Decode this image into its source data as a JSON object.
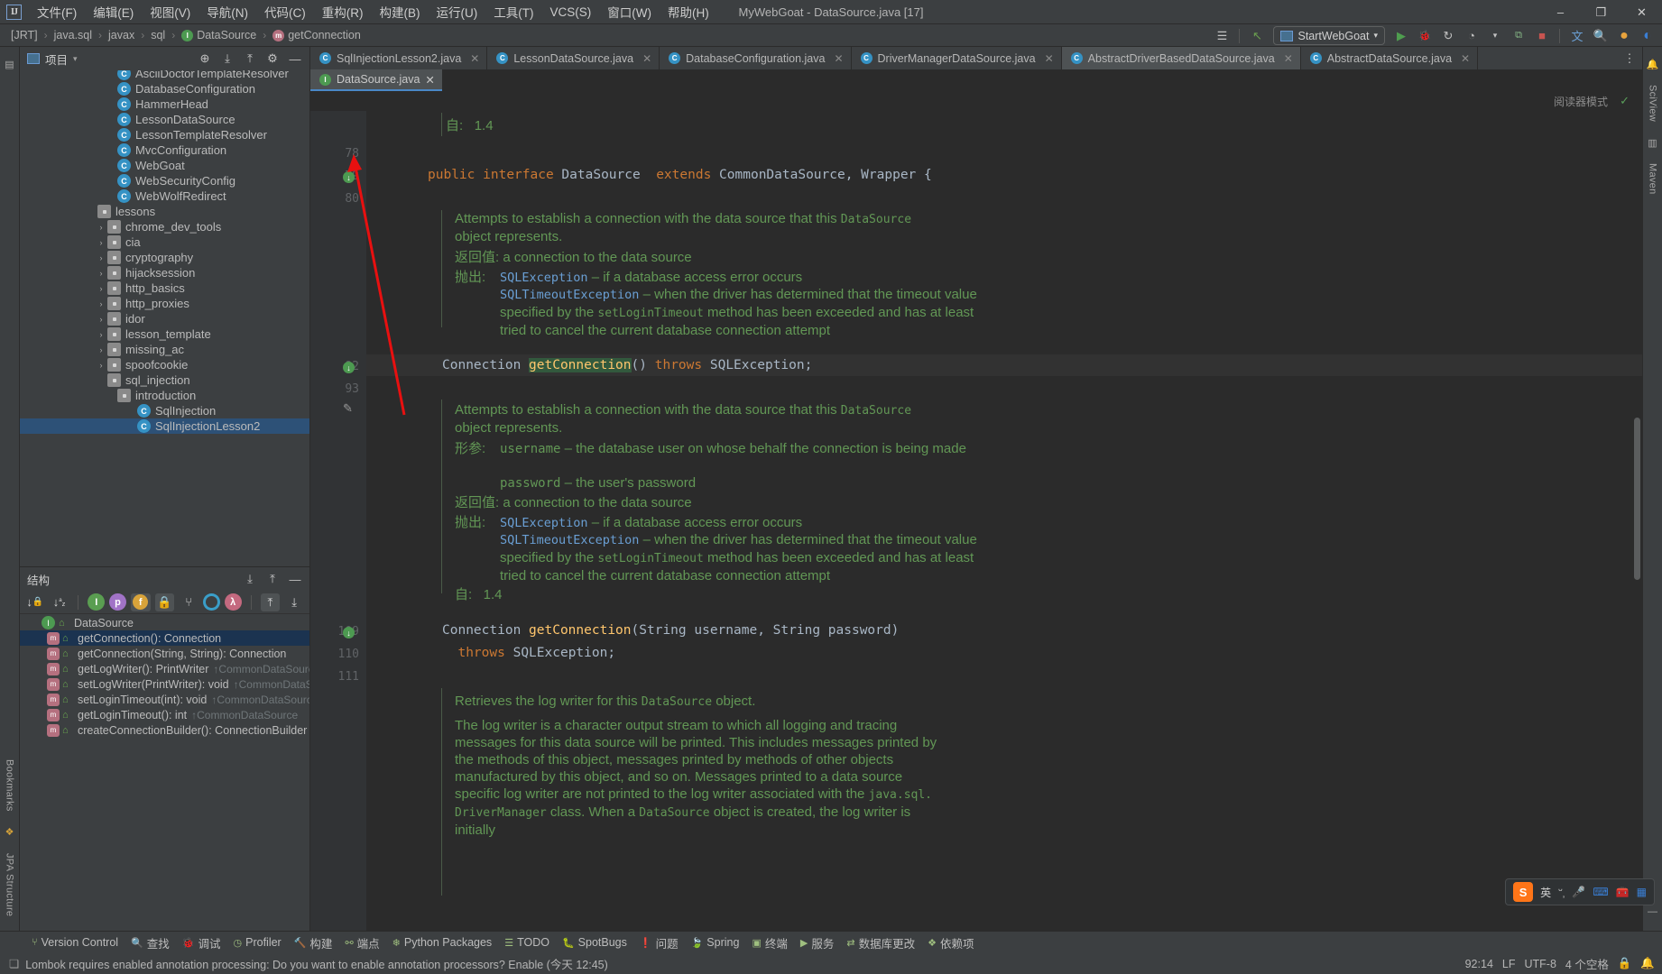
{
  "window": {
    "title": "MyWebGoat - DataSource.java [17]",
    "logo": "IJ",
    "minimize": "–",
    "maximize": "❐",
    "close": "✕"
  },
  "menu": {
    "items": [
      {
        "label": "文件(F)",
        "name": "menu-file"
      },
      {
        "label": "编辑(E)",
        "name": "menu-edit"
      },
      {
        "label": "视图(V)",
        "name": "menu-view"
      },
      {
        "label": "导航(N)",
        "name": "menu-navigate"
      },
      {
        "label": "代码(C)",
        "name": "menu-code"
      },
      {
        "label": "重构(R)",
        "name": "menu-refactor"
      },
      {
        "label": "构建(B)",
        "name": "menu-build"
      },
      {
        "label": "运行(U)",
        "name": "menu-run"
      },
      {
        "label": "工具(T)",
        "name": "menu-tools"
      },
      {
        "label": "VCS(S)",
        "name": "menu-vcs"
      },
      {
        "label": "窗口(W)",
        "name": "menu-window"
      },
      {
        "label": "帮助(H)",
        "name": "menu-help"
      }
    ]
  },
  "navbar": {
    "crumbs": [
      {
        "label": "[JRT]",
        "icon": ""
      },
      {
        "label": "java.sql",
        "icon": ""
      },
      {
        "label": "javax",
        "icon": ""
      },
      {
        "label": "sql",
        "icon": ""
      },
      {
        "label": "DataSource",
        "icon": "interface-icon"
      },
      {
        "label": "getConnection",
        "icon": "method-icon"
      }
    ],
    "separator": "›",
    "run_config": "StartWebGoat",
    "icons": {
      "profile": "☰",
      "back": "↖",
      "run": "▶",
      "debug": "🐞",
      "rerun": "↻",
      "coverage": "◔",
      "stop": "■",
      "translate": "文",
      "search": "🔍",
      "notify": "●",
      "updates": "◐"
    }
  },
  "project_panel": {
    "title": "项目",
    "dropdown": "▾",
    "actions": [
      "locate-icon",
      "expand-all-icon",
      "collapse-all-icon",
      "settings-icon",
      "hide-icon"
    ],
    "tree": [
      {
        "label": "AsciiDoctorTemplateResolver",
        "type": "class",
        "indent": 8,
        "arrow": "",
        "clipped": true
      },
      {
        "label": "DatabaseConfiguration",
        "type": "class",
        "indent": 8,
        "arrow": ""
      },
      {
        "label": "HammerHead",
        "type": "class",
        "indent": 8,
        "arrow": ""
      },
      {
        "label": "LessonDataSource",
        "type": "class",
        "indent": 8,
        "arrow": ""
      },
      {
        "label": "LessonTemplateResolver",
        "type": "class",
        "indent": 8,
        "arrow": ""
      },
      {
        "label": "MvcConfiguration",
        "type": "class",
        "indent": 8,
        "arrow": ""
      },
      {
        "label": "WebGoat",
        "type": "class-run",
        "indent": 8,
        "arrow": ""
      },
      {
        "label": "WebSecurityConfig",
        "type": "class",
        "indent": 8,
        "arrow": ""
      },
      {
        "label": "WebWolfRedirect",
        "type": "class",
        "indent": 8,
        "arrow": ""
      },
      {
        "label": "lessons",
        "type": "folder",
        "indent": 6,
        "arrow": "ⱟ"
      },
      {
        "label": "chrome_dev_tools",
        "type": "folder",
        "indent": 7,
        "arrow": "›"
      },
      {
        "label": "cia",
        "type": "folder",
        "indent": 7,
        "arrow": "›"
      },
      {
        "label": "cryptography",
        "type": "folder",
        "indent": 7,
        "arrow": "›"
      },
      {
        "label": "hijacksession",
        "type": "folder",
        "indent": 7,
        "arrow": "›"
      },
      {
        "label": "http_basics",
        "type": "folder",
        "indent": 7,
        "arrow": "›"
      },
      {
        "label": "http_proxies",
        "type": "folder",
        "indent": 7,
        "arrow": "›"
      },
      {
        "label": "idor",
        "type": "folder",
        "indent": 7,
        "arrow": "›"
      },
      {
        "label": "lesson_template",
        "type": "folder",
        "indent": 7,
        "arrow": "›"
      },
      {
        "label": "missing_ac",
        "type": "folder",
        "indent": 7,
        "arrow": "›"
      },
      {
        "label": "spoofcookie",
        "type": "folder",
        "indent": 7,
        "arrow": "›"
      },
      {
        "label": "sql_injection",
        "type": "folder",
        "indent": 7,
        "arrow": "ⱟ"
      },
      {
        "label": "introduction",
        "type": "folder",
        "indent": 8,
        "arrow": "ⱟ"
      },
      {
        "label": "SqlInjection",
        "type": "class",
        "indent": 10,
        "arrow": ""
      },
      {
        "label": "SqlInjectionLesson2",
        "type": "class",
        "indent": 10,
        "arrow": "",
        "selected": true
      }
    ]
  },
  "structure_panel": {
    "title": "结构",
    "toolbar_icons": [
      "sort-by-visibility-icon",
      "sort-alphabetically-icon",
      "show-inherited-icon",
      "show-properties-icon",
      "show-fields-icon",
      "show-non-public-icon",
      "group-icon",
      "show-anonymous-icon",
      "show-lambdas-icon",
      "expand-all-icon",
      "collapse-all-icon"
    ],
    "header_actions": [
      "expand-all-icon",
      "collapse-all-icon",
      "hide-icon"
    ],
    "items": [
      {
        "label": "DataSource",
        "type": "interface",
        "indent": 0,
        "arrow": "ⱟ",
        "lock": "⌂",
        "origin": ""
      },
      {
        "label": "getConnection(): Connection",
        "type": "method",
        "indent": 1,
        "arrow": "",
        "lock": "⌂",
        "origin": "",
        "selected": true
      },
      {
        "label": "getConnection(String, String): Connection",
        "type": "method",
        "indent": 1,
        "arrow": "",
        "lock": "⌂",
        "origin": ""
      },
      {
        "label": "getLogWriter(): PrintWriter",
        "type": "method",
        "indent": 1,
        "arrow": "",
        "lock": "⌂",
        "origin": "↑CommonDataSource"
      },
      {
        "label": "setLogWriter(PrintWriter): void",
        "type": "method",
        "indent": 1,
        "arrow": "",
        "lock": "⌂",
        "origin": "↑CommonDataSource"
      },
      {
        "label": "setLoginTimeout(int): void",
        "type": "method",
        "indent": 1,
        "arrow": "",
        "lock": "⌂",
        "origin": "↑CommonDataSource"
      },
      {
        "label": "getLoginTimeout(): int",
        "type": "method",
        "indent": 1,
        "arrow": "",
        "lock": "⌂",
        "origin": "↑CommonDataSource"
      },
      {
        "label": "createConnectionBuilder(): ConnectionBuilder",
        "type": "method",
        "indent": 1,
        "arrow": "",
        "lock": "⌂",
        "origin": ""
      }
    ]
  },
  "editor": {
    "tabs_row1": [
      {
        "label": "SqlInjectionLesson2.java",
        "icon": "class-icon",
        "active": false
      },
      {
        "label": "LessonDataSource.java",
        "icon": "class-icon",
        "active": false
      },
      {
        "label": "DatabaseConfiguration.java",
        "icon": "class-icon",
        "active": false
      },
      {
        "label": "DriverManagerDataSource.java",
        "icon": "class-icon",
        "active": false
      },
      {
        "label": "AbstractDriverBasedDataSource.java",
        "icon": "class-icon",
        "active": true
      },
      {
        "label": "AbstractDataSource.java",
        "icon": "class-icon",
        "active": false
      }
    ],
    "tabs_row2": [
      {
        "label": "DataSource.java",
        "icon": "interface-icon",
        "active": true
      }
    ],
    "tab_close": "✕",
    "reader_mode": "阅读器模式",
    "line_numbers": [
      "78",
      "79",
      "80",
      "92",
      "93",
      "109",
      "110",
      "111"
    ],
    "code_lines": [
      {
        "line": 79,
        "tokens": [
          {
            "t": "public",
            "c": "kw"
          },
          {
            "t": " ",
            "c": "plain"
          },
          {
            "t": "interface",
            "c": "kw"
          },
          {
            "t": " DataSource  ",
            "c": "cls"
          },
          {
            "t": "extends",
            "c": "kw"
          },
          {
            "t": " CommonDataSource, Wrapper {",
            "c": "cls"
          }
        ]
      },
      {
        "line": 92,
        "tokens": [
          {
            "t": "Connection ",
            "c": "cls"
          },
          {
            "t": "getConnection",
            "c": "mthhl"
          },
          {
            "t": "() ",
            "c": "cls"
          },
          {
            "t": "throws",
            "c": "kw"
          },
          {
            "t": " SQLException;",
            "c": "cls"
          }
        ]
      },
      {
        "line": 109,
        "tokens": [
          {
            "t": "Connection ",
            "c": "cls"
          },
          {
            "t": "getConnection",
            "c": "mth"
          },
          {
            "t": "(String username, String password)",
            "c": "cls"
          }
        ]
      },
      {
        "line": 110,
        "tokens": [
          {
            "t": "  ",
            "c": "plain"
          },
          {
            "t": "throws",
            "c": "kw"
          },
          {
            "t": " SQLException;",
            "c": "cls"
          }
        ]
      }
    ],
    "doc_blocks": [
      {
        "id": "top-since",
        "lines": [
          {
            "label": "自:",
            "text": "1.4"
          }
        ]
      },
      {
        "id": "doc1",
        "para": [
          "Attempts to establish a connection with the data source that this DataSource",
          "object represents."
        ],
        "returns_label": "返回值:",
        "returns_text": "a connection to the data source",
        "throws_label": "抛出:",
        "throws": [
          {
            "type": "SQLException",
            "desc": "– if a database access error occurs"
          },
          {
            "type": "SQLTimeoutException",
            "desc": "– when the driver has determined that the timeout value specified by the setLoginTimeout method has been exceeded and has at least tried to cancel the current database connection attempt"
          }
        ]
      },
      {
        "id": "doc2",
        "para": [
          "Attempts to establish a connection with the data source that this DataSource",
          "object represents."
        ],
        "params_label": "形参:",
        "params": [
          {
            "name": "username",
            "desc": "– the database user on whose behalf the connection is being made"
          },
          {
            "name": "password",
            "desc": "– the user's password"
          }
        ],
        "returns_label": "返回值:",
        "returns_text": "a connection to the data source",
        "throws_label": "抛出:",
        "throws": [
          {
            "type": "SQLException",
            "desc": "– if a database access error occurs"
          },
          {
            "type": "SQLTimeoutException",
            "desc": "– when the driver has determined that the timeout value specified by the setLoginTimeout method has been exceeded and has at least tried to cancel the current database connection attempt"
          }
        ],
        "since_label": "自:",
        "since_text": "1.4"
      },
      {
        "id": "doc3",
        "para": [
          "Retrieves the log writer for this DataSource object.",
          "The log writer is a character output stream to which all logging and tracing messages for this data source will be printed. This includes messages printed by the methods of this object, messages printed by methods of other objects manufactured by this object, and so on. Messages printed to a data source specific log writer are not printed to the log writer associated with the java.sql. DriverManager class. When a DataSource object is created, the log writer is initially"
        ]
      }
    ]
  },
  "ime": {
    "logo": "S",
    "mode": "英",
    "icons": [
      "half-width-icon",
      "mic-icon",
      "keyboard-icon",
      "toolbox-icon",
      "apps-icon"
    ]
  },
  "left_strip": {
    "items": [
      {
        "label": "Bookmarks",
        "name": "tool-bookmarks"
      },
      {
        "label": "JPA Structure",
        "name": "tool-jpa-structure"
      }
    ]
  },
  "right_strip": {
    "items": [
      {
        "label": "Notifications",
        "name": "tool-notifications"
      },
      {
        "label": "SciView",
        "name": "tool-sciview"
      },
      {
        "label": "Maven",
        "name": "tool-maven"
      }
    ]
  },
  "bottom_toolbar": {
    "items": [
      {
        "label": "Version Control",
        "icon": "branch-icon"
      },
      {
        "label": "查找",
        "icon": "search-icon"
      },
      {
        "label": "调试",
        "icon": "debug-icon"
      },
      {
        "label": "Profiler",
        "icon": "profiler-icon"
      },
      {
        "label": "构建",
        "icon": "build-icon"
      },
      {
        "label": "端点",
        "icon": "endpoints-icon"
      },
      {
        "label": "Python Packages",
        "icon": "python-icon"
      },
      {
        "label": "TODO",
        "icon": "todo-icon"
      },
      {
        "label": "SpotBugs",
        "icon": "spotbugs-icon"
      },
      {
        "label": "问题",
        "icon": "problems-icon"
      },
      {
        "label": "Spring",
        "icon": "spring-icon"
      },
      {
        "label": "终端",
        "icon": "terminal-icon"
      },
      {
        "label": "服务",
        "icon": "services-icon"
      },
      {
        "label": "数据库更改",
        "icon": "db-changes-icon"
      },
      {
        "label": "依赖项",
        "icon": "dependencies-icon"
      }
    ]
  },
  "status_bar": {
    "message": "Lombok requires enabled annotation processing: Do you want to enable annotation processors? Enable (今天 12:45)",
    "message_icon": "info-icon",
    "caret": "92:14",
    "line_sep": "LF",
    "encoding": "UTF-8",
    "indent": "4 个空格",
    "lock_icon": "lock-icon",
    "bell_icon": "bell-icon"
  }
}
